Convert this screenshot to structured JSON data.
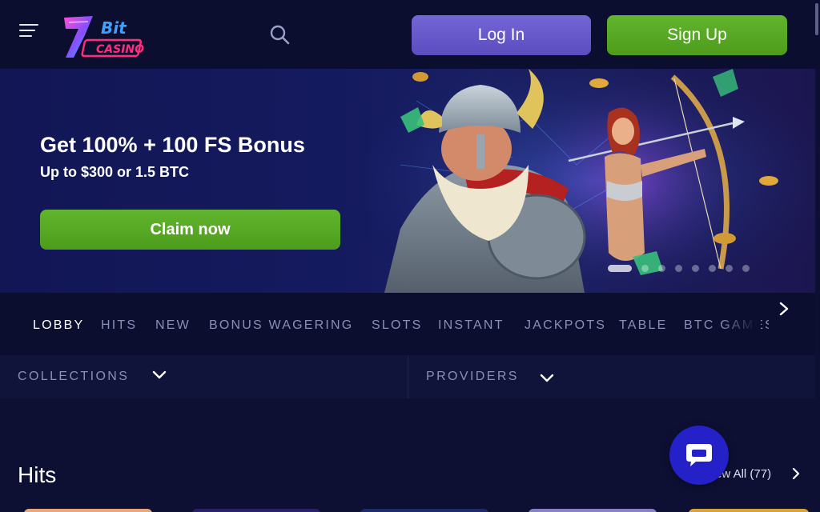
{
  "header": {
    "logo_text": "7Bit CASINO",
    "login_label": "Log In",
    "signup_label": "Sign Up"
  },
  "banner": {
    "title": "Get 100% + 100 FS Bonus",
    "subtitle": "Up to $300 or 1.5 BTC",
    "cta_label": "Claim now",
    "slide_count": 9,
    "active_slide": 1
  },
  "categories": [
    {
      "label": "LOBBY",
      "active": true
    },
    {
      "label": "HITS"
    },
    {
      "label": "NEW"
    },
    {
      "label": "BONUS WAGERING"
    },
    {
      "label": "SLOTS"
    },
    {
      "label": "INSTANT"
    },
    {
      "label": "JACKPOTS"
    },
    {
      "label": "TABLE"
    },
    {
      "label": "BTC GAMES"
    }
  ],
  "filters": {
    "collections_label": "COLLECTIONS",
    "providers_label": "PROVIDERS"
  },
  "hits": {
    "title": "Hits",
    "view_all_label": "View All (77)"
  },
  "colors": {
    "background": "#0d1033",
    "header": "#0b0e2e",
    "login": "#6a5cd0",
    "signup": "#58a825",
    "chat": "#2421c9"
  },
  "icons": [
    "menu-icon",
    "search-icon",
    "chevron-right-icon",
    "chevron-down-icon",
    "chat-icon"
  ]
}
